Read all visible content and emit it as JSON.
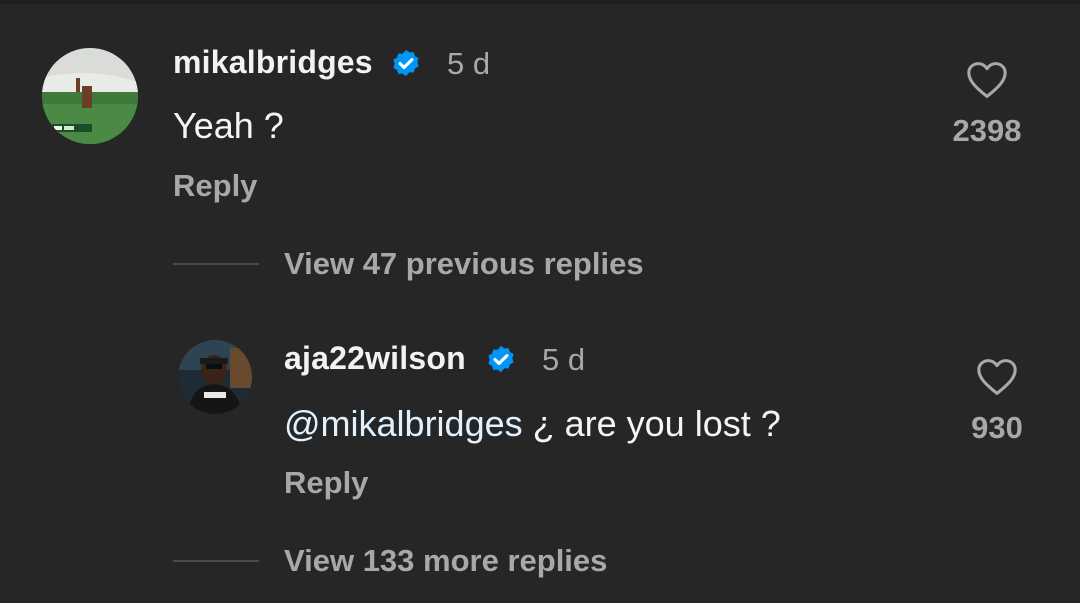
{
  "comments": [
    {
      "username": "mikalbridges",
      "verified": true,
      "time": "5 d",
      "text": "Yeah ?",
      "reply_label": "Reply",
      "like_count": "2398",
      "avatar_icon": "avatar-football-field"
    },
    {
      "username": "aja22wilson",
      "verified": true,
      "time": "5 d",
      "mention": "@mikalbridges",
      "text": " ¿ are you lost ?",
      "reply_label": "Reply",
      "like_count": "930",
      "avatar_icon": "avatar-person"
    }
  ],
  "view_previous_label": "View 47 previous replies",
  "view_more_label": "View 133 more replies",
  "colors": {
    "background": "#262626",
    "verified_blue": "#0095f6",
    "muted_text": "#a8a8a8",
    "mention": "#e0f1ff"
  },
  "icons": {
    "verified": "verified-badge-icon",
    "like": "heart-outline-icon"
  }
}
